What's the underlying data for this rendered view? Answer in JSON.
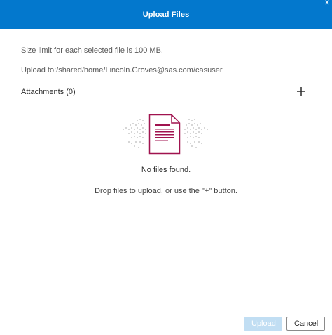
{
  "dialog": {
    "title": "Upload Files",
    "close_icon": "close-icon",
    "size_limit_text": "Size limit for each selected file is 100 MB.",
    "upload_to_text": "Upload to:/shared/home/Lincoln.Groves@sas.com/casuser",
    "attachments_label": "Attachments (0)",
    "add_icon": "plus-icon",
    "empty_graphic_icon": "document-icon",
    "no_files_text": "No files found.",
    "drop_hint_text": "Drop files to upload, or use the \"+\" button.",
    "upload_label": "Upload",
    "cancel_label": "Cancel"
  },
  "colors": {
    "header": "#0378cd",
    "document_accent": "#a0134f",
    "upload_disabled": "#c1def3"
  }
}
